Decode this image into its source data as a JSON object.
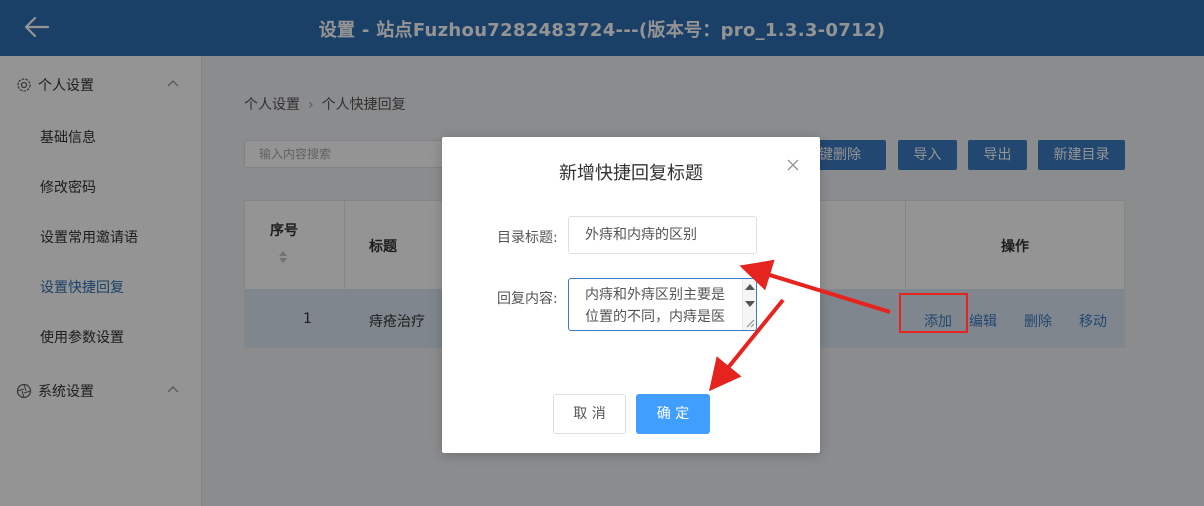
{
  "header": {
    "title": "设置 - 站点Fuzhou7282483724---(版本号：pro_1.3.3-0712)",
    "back_icon": "arrow-left-icon"
  },
  "sidebar": {
    "groups": [
      {
        "label": "个人设置",
        "icon": "gear-icon",
        "expanded": true
      },
      {
        "label": "系统设置",
        "icon": "aperture-icon",
        "expanded": true
      }
    ],
    "items": [
      {
        "label": "基础信息",
        "active": false
      },
      {
        "label": "修改密码",
        "active": false
      },
      {
        "label": "设置常用邀请语",
        "active": false
      },
      {
        "label": "设置快捷回复",
        "active": true
      },
      {
        "label": "使用参数设置",
        "active": false
      }
    ]
  },
  "breadcrumb": {
    "items": [
      "个人设置",
      "个人快捷回复"
    ]
  },
  "search": {
    "placeholder": "输入内容搜索"
  },
  "toolbar": {
    "delete_all": "一键删除",
    "import": "导入",
    "export": "导出",
    "new_dir": "新建目录"
  },
  "table": {
    "headers": {
      "index": "序号",
      "title": "标题",
      "ops": "操作"
    },
    "rows": [
      {
        "index": "1",
        "title": "痔疮治疗",
        "ops": [
          "添加",
          "编辑",
          "删除",
          "移动"
        ]
      }
    ]
  },
  "dialog": {
    "title": "新增快捷回复标题",
    "dir_label": "目录标题:",
    "dir_value": "外痔和内痔的区别",
    "reply_label": "回复内容:",
    "reply_value": "内痔和外痔区别主要是位置的不同，内痔是医学上齿线以上的",
    "cancel": "取 消",
    "confirm": "确 定"
  },
  "colors": {
    "header": "#2f6fb3",
    "accent": "#3b7ac3",
    "primary_button": "#409eff",
    "annotation": "#e52420"
  }
}
